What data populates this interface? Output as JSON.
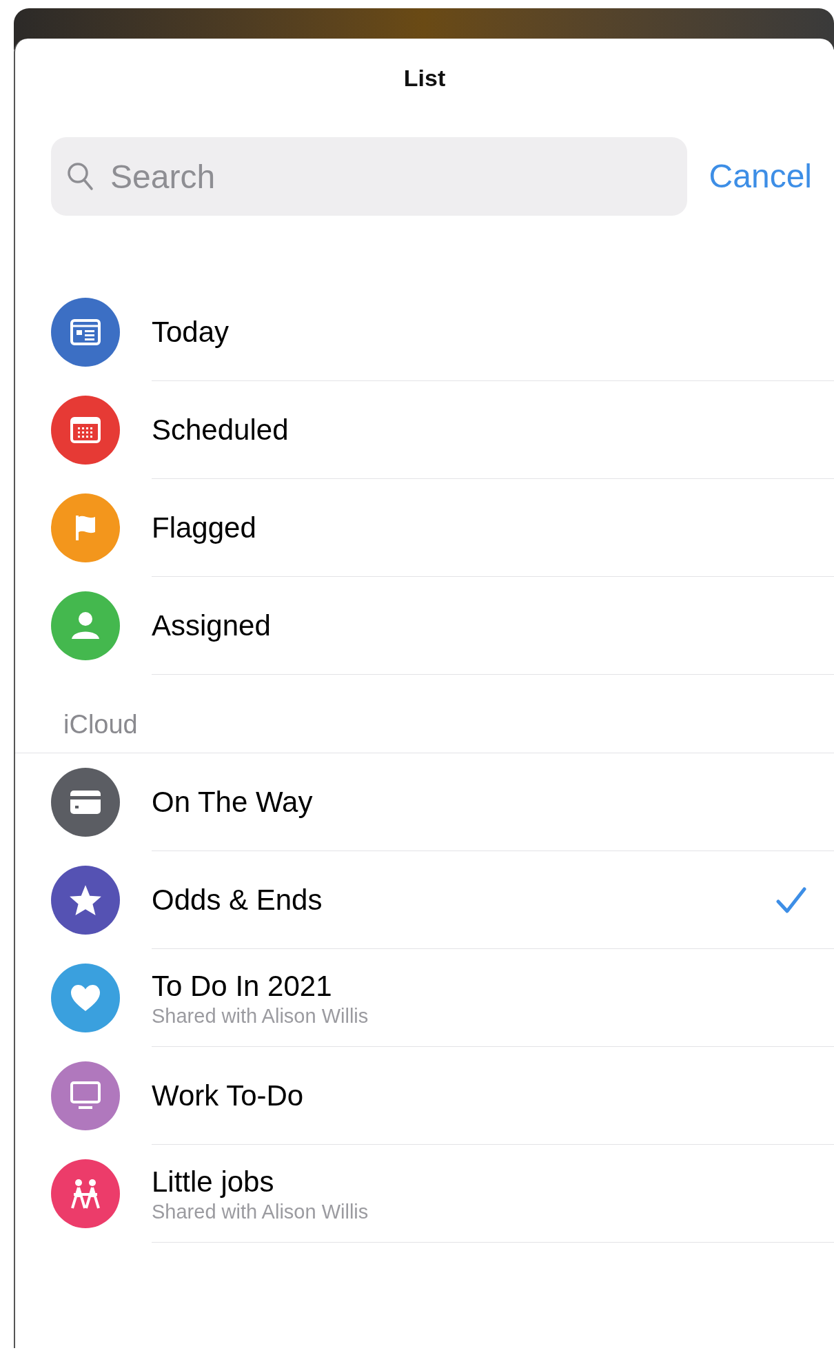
{
  "sheet": {
    "title": "List"
  },
  "search": {
    "placeholder": "Search"
  },
  "cancel": "Cancel",
  "sections": [
    {
      "items": [
        {
          "name": "Today",
          "kind": "today",
          "color": "#3c6fc4",
          "selected": false
        },
        {
          "name": "Scheduled",
          "kind": "calendar",
          "color": "#e63a35",
          "selected": false
        },
        {
          "name": "Flagged",
          "kind": "flag",
          "color": "#f3961c",
          "selected": false
        },
        {
          "name": "Assigned",
          "kind": "person",
          "color": "#44b84e",
          "selected": false
        }
      ]
    },
    {
      "header": "iCloud",
      "items": [
        {
          "name": "On The Way",
          "kind": "card",
          "color": "#5b5d63",
          "selected": false
        },
        {
          "name": "Odds & Ends",
          "kind": "star",
          "color": "#5552b3",
          "selected": true
        },
        {
          "name": "To Do In 2021",
          "subtitle": "Shared with Alison Willis",
          "kind": "heart",
          "color": "#3aa0de",
          "selected": false
        },
        {
          "name": "Work To-Do",
          "kind": "monitor",
          "color": "#b078bd",
          "selected": false
        },
        {
          "name": "Little jobs",
          "subtitle": "Shared with Alison Willis",
          "kind": "people",
          "color": "#ec3c6a",
          "selected": false
        }
      ]
    }
  ]
}
